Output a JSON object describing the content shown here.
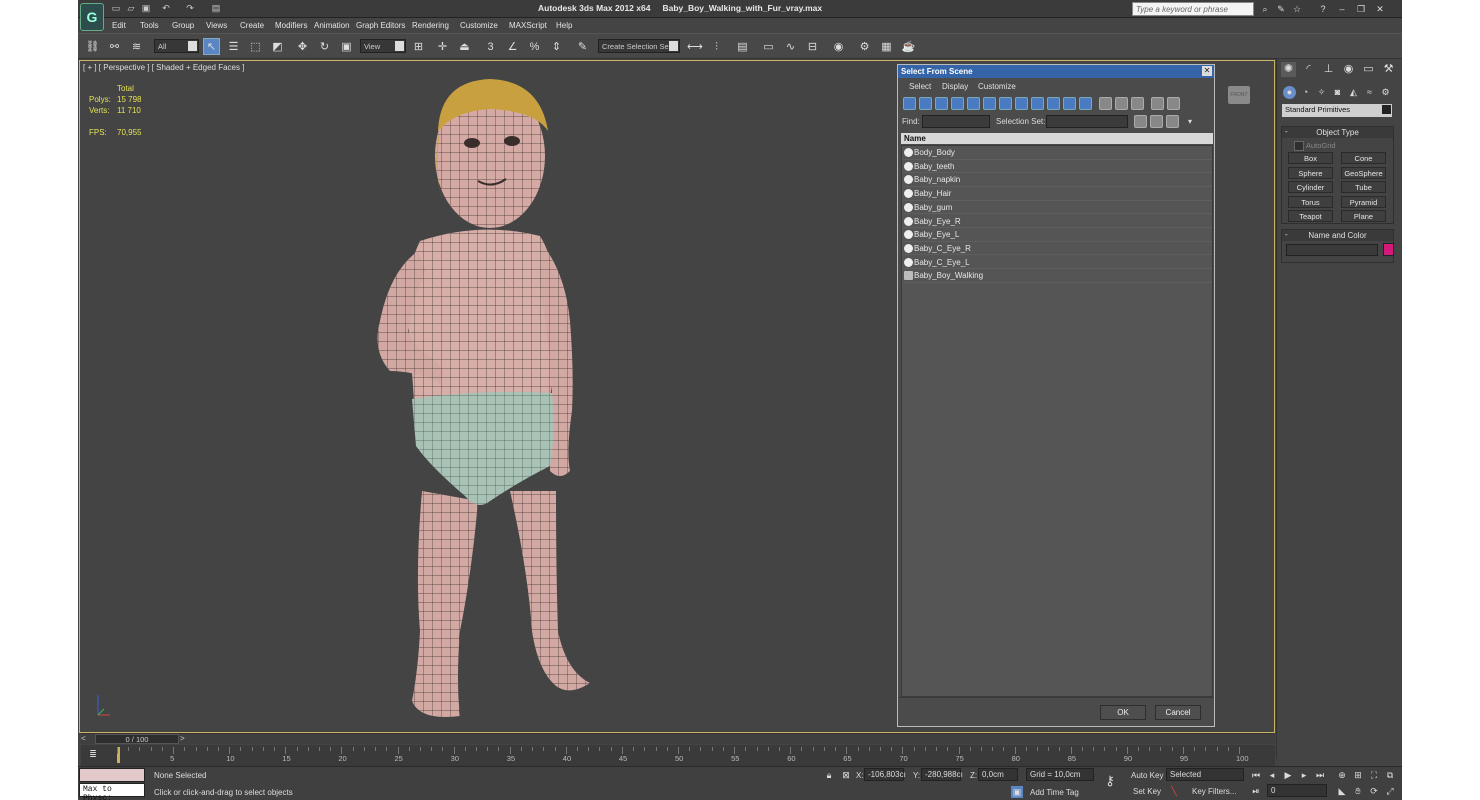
{
  "title": {
    "app": "Autodesk 3ds Max  2012 x64",
    "file": "Baby_Boy_Walking_with_Fur_vray.max"
  },
  "search": {
    "placeholder": "Type a keyword or phrase"
  },
  "menu": [
    "Edit",
    "Tools",
    "Group",
    "Views",
    "Create",
    "Modifiers",
    "Animation",
    "Graph Editors",
    "Rendering",
    "Customize",
    "MAXScript",
    "Help"
  ],
  "toolbar": {
    "selection_filter": "All",
    "ref_coord": "View",
    "named_selection": "Create Selection Se"
  },
  "viewport": {
    "label": "[ + ] [ Perspective ] [ Shaded + Edged Faces ]",
    "stats": {
      "total_label": "Total",
      "polys_label": "Polys:",
      "polys": "15 798",
      "verts_label": "Verts:",
      "verts": "11 710",
      "fps_label": "FPS:",
      "fps": "70,955"
    },
    "navcube_label": "FRONT"
  },
  "dialog": {
    "title": "Select From Scene",
    "menu": [
      "Select",
      "Display",
      "Customize"
    ],
    "find_label": "Find:",
    "selset_label": "Selection Set:",
    "column_name": "Name",
    "items": [
      "Body_Body",
      "Baby_teeth",
      "Baby_napkin",
      "Baby_Hair",
      "Baby_gum",
      "Baby_Eye_R",
      "Baby_Eye_L",
      "Baby_C_Eye_R",
      "Baby_C_Eye_L",
      "Baby_Boy_Walking"
    ],
    "ok": "OK",
    "cancel": "Cancel"
  },
  "command_panel": {
    "category": "Standard Primitives",
    "object_type_title": "Object Type",
    "autogrid": "AutoGrid",
    "buttons": [
      "Box",
      "Cone",
      "Sphere",
      "GeoSphere",
      "Cylinder",
      "Tube",
      "Torus",
      "Pyramid",
      "Teapot",
      "Plane"
    ],
    "name_color_title": "Name and Color",
    "object_color": "#d4197a"
  },
  "timeline": {
    "slider": "0 / 100",
    "prev": "<",
    "next": ">",
    "ticks": [
      "5",
      "10",
      "15",
      "20",
      "25",
      "30",
      "35",
      "40",
      "45",
      "50",
      "55",
      "60",
      "65",
      "70",
      "75",
      "80",
      "85",
      "90",
      "95",
      "100"
    ]
  },
  "status": {
    "listener": "Max to Physc:",
    "selected": "None Selected",
    "prompt": "Click or click-and-drag to select objects",
    "x_label": "X:",
    "x": "-106,803cı",
    "y_label": "Y:",
    "y": "-280,988cı",
    "z_label": "Z:",
    "z": "0,0cm",
    "grid": "Grid = 10,0cm",
    "add_time_tag": "Add Time Tag",
    "auto_key": "Auto Key",
    "set_key": "Set Key",
    "key_mode": "Selected",
    "key_filters": "Key Filters...",
    "frame": "0"
  }
}
